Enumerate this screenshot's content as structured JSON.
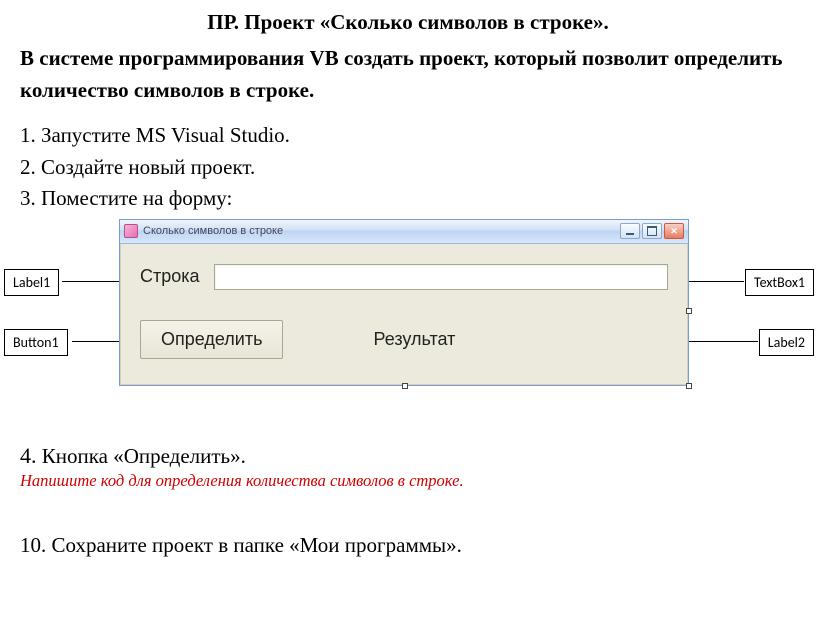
{
  "heading": "ПР. Проект «Сколько символов в строке».",
  "subheading": "В системе программирования VB создать проект, который позволит определить количество символов в строке.",
  "steps": {
    "s1": "1. Запустите MS Visual Studio.",
    "s2": "2. Создайте новый проект.",
    "s3": "3. Поместите на форму:"
  },
  "callouts": {
    "label1": "Label1",
    "button1": "Button1",
    "textbox1": "TextBox1",
    "label2": "Label2"
  },
  "window": {
    "title": "Сколько символов в строке",
    "label_stroka": "Строка",
    "button_define": "Определить",
    "label_result": "Результат"
  },
  "step4": {
    "num": "4.",
    "rest": " Кнопка «Определить».",
    "hint": "Напишите код для определения количества символов в строке."
  },
  "step10": "10. Сохраните проект в папке «Мои программы»."
}
